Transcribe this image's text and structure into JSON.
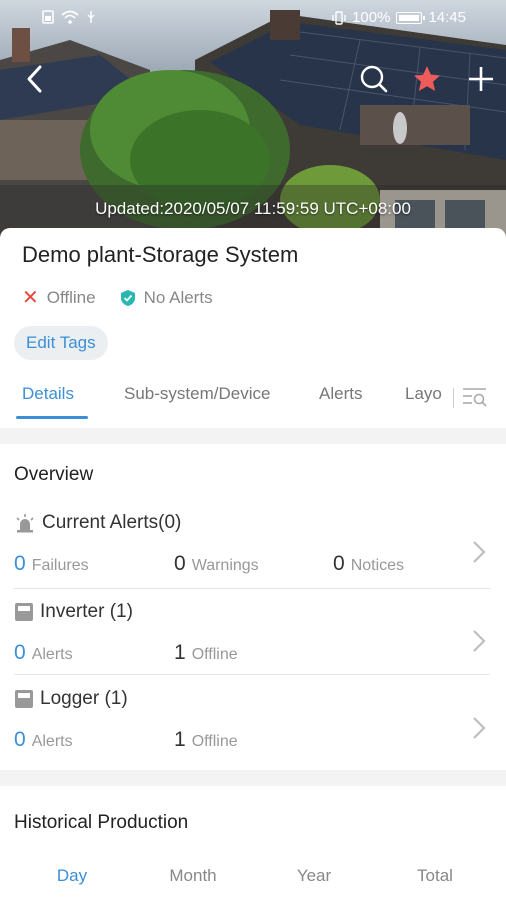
{
  "statusbar": {
    "battery_percent": "100%",
    "time": "14:45"
  },
  "header": {
    "updated": "Updated:2020/05/07 11:59:59 UTC+08:00",
    "icons": [
      "back-icon",
      "search-icon",
      "star-icon",
      "add-icon"
    ],
    "accent_star": "#ef5b5b"
  },
  "plant": {
    "title": "Demo plant-Storage System",
    "status": "Offline",
    "alerts_status": "No Alerts",
    "edit_tags": "Edit Tags"
  },
  "tabs": [
    {
      "label": "Details",
      "active": true
    },
    {
      "label": "Sub-system/Device"
    },
    {
      "label": "Alerts"
    },
    {
      "label": "Layo"
    }
  ],
  "overview": {
    "title": "Overview",
    "current_alerts": {
      "label": "Current Alerts(0)",
      "failures_num": "0",
      "failures_label": "Failures",
      "warnings_num": "0",
      "warnings_label": "Warnings",
      "notices_num": "0",
      "notices_label": "Notices"
    },
    "inverter": {
      "label": "Inverter (1)",
      "alerts_num": "0",
      "alerts_label": "Alerts",
      "offline_num": "1",
      "offline_label": "Offline"
    },
    "logger": {
      "label": "Logger (1)",
      "alerts_num": "0",
      "alerts_label": "Alerts",
      "offline_num": "1",
      "offline_label": "Offline"
    }
  },
  "historical": {
    "title": "Historical Production",
    "periods": [
      "Day",
      "Month",
      "Year",
      "Total"
    ],
    "active_period": "Day"
  },
  "colors": {
    "accent": "#3b8fd6",
    "offline_red": "#e9463c",
    "ok_teal": "#27b8b0"
  }
}
